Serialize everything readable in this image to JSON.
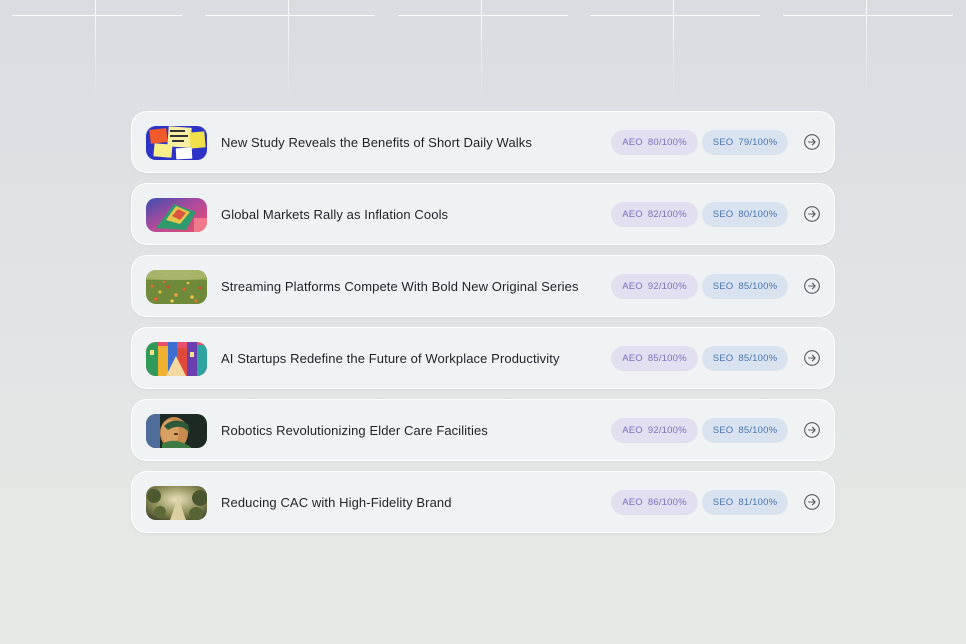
{
  "articles": [
    {
      "title": "New Study Reveals the Benefits of Short Daily Walks",
      "aeo_label": "AEO",
      "aeo_score": "80/100%",
      "seo_label": "SEO",
      "seo_score": "79/100%",
      "thumbnail": "sticky-notes-collage"
    },
    {
      "title": "Global Markets Rally as Inflation Cools",
      "aeo_label": "AEO",
      "aeo_score": "82/100%",
      "seo_label": "SEO",
      "seo_score": "80/100%",
      "thumbnail": "abstract-colorful-shapes"
    },
    {
      "title": "Streaming Platforms Compete With Bold New Original Series",
      "aeo_label": "AEO",
      "aeo_score": "92/100%",
      "seo_label": "SEO",
      "seo_score": "85/100%",
      "thumbnail": "flower-field"
    },
    {
      "title": "AI Startups Redefine the Future of Workplace Productivity",
      "aeo_label": "AEO",
      "aeo_score": "85/100%",
      "seo_label": "SEO",
      "seo_score": "85/100%",
      "thumbnail": "colorful-street"
    },
    {
      "title": "Robotics Revolutionizing Elder Care Facilities",
      "aeo_label": "AEO",
      "aeo_score": "92/100%",
      "seo_label": "SEO",
      "seo_score": "85/100%",
      "thumbnail": "face-portrait"
    },
    {
      "title": "Reducing CAC with High-Fidelity Brand",
      "aeo_label": "AEO",
      "aeo_score": "86/100%",
      "seo_label": "SEO",
      "seo_score": "81/100%",
      "thumbnail": "forest-path"
    }
  ],
  "icons": {
    "open": "arrow-right-circle-icon"
  },
  "colors": {
    "aeo_bg": "#e2e0f0",
    "aeo_text": "#7d6fbf",
    "seo_bg": "#d9e3ef",
    "seo_text": "#4c74b0"
  }
}
